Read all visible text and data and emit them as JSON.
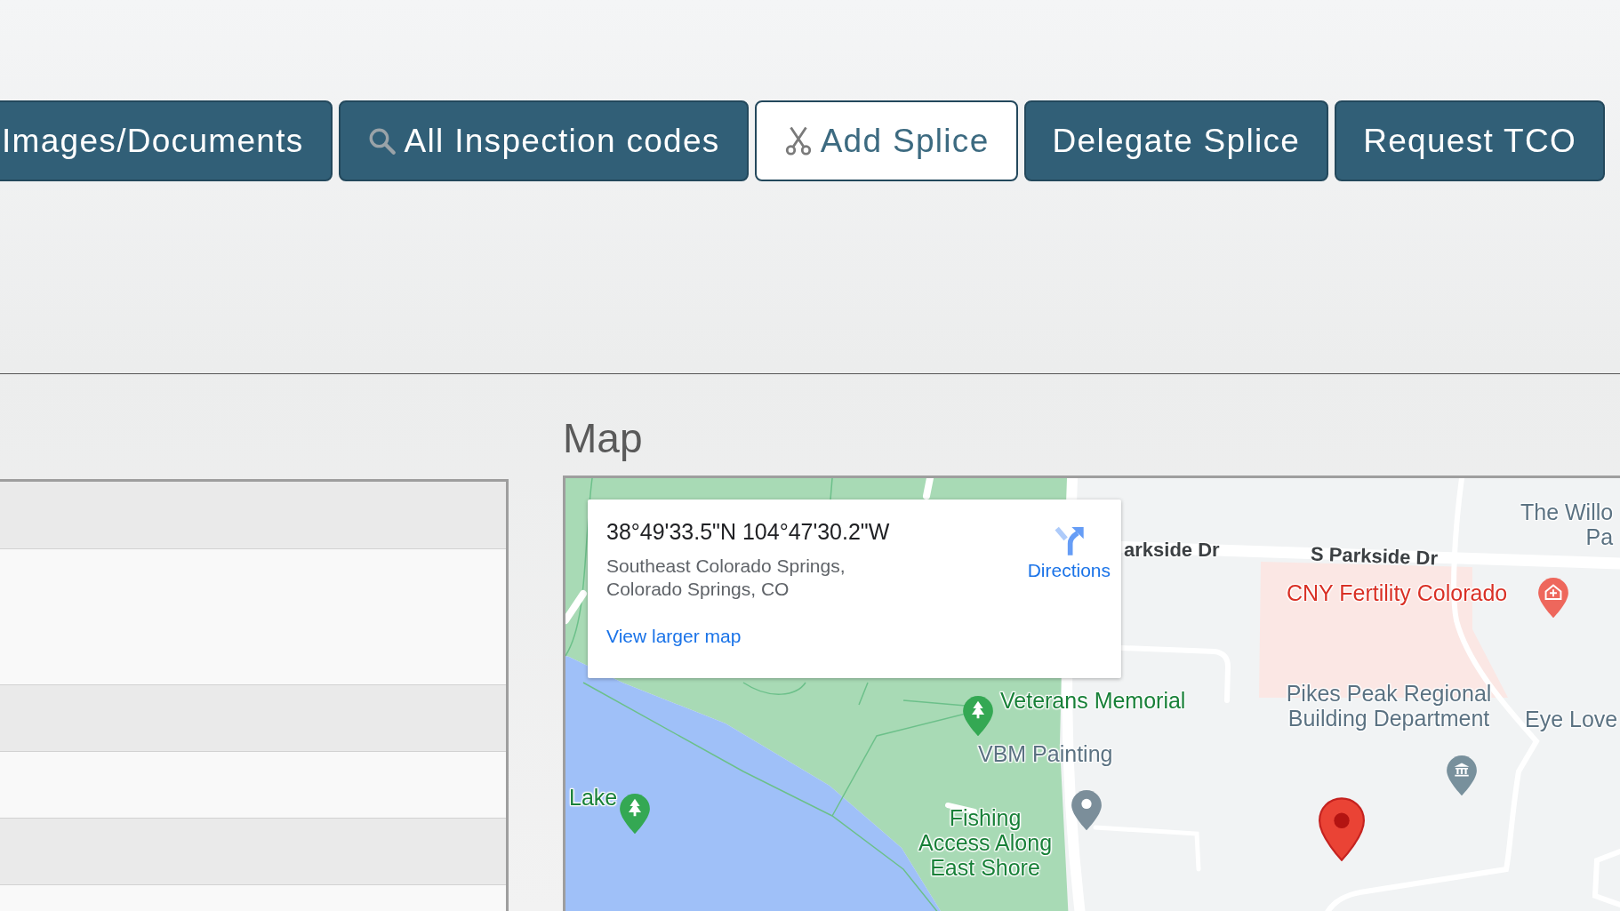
{
  "toolbar": {
    "buttons": [
      {
        "label": "Images/Documents",
        "kind": "plain",
        "hovered": false
      },
      {
        "label": "All Inspection codes",
        "kind": "search",
        "hovered": false
      },
      {
        "label": "Add Splice",
        "kind": "scissors",
        "hovered": true
      },
      {
        "label": "Delegate Splice",
        "kind": "plain",
        "hovered": false
      },
      {
        "label": "Request TCO",
        "kind": "plain",
        "hovered": false
      }
    ]
  },
  "map": {
    "heading": "Map",
    "popup": {
      "coordinates": "38°49'33.5\"N 104°47'30.2\"W",
      "address": "Southeast Colorado Springs, Colorado Springs, CO",
      "directions": "Directions",
      "link": "View larger map"
    },
    "labels": [
      {
        "text": "arkside Dr",
        "kind": "road"
      },
      {
        "text": "S Parkside Dr",
        "kind": "road"
      },
      {
        "text": "The Willo\nPa",
        "kind": "poi"
      },
      {
        "text": "CNY Fertility Colorado",
        "kind": "medical"
      },
      {
        "text": "Pikes Peak Regional\nBuilding Department",
        "kind": "poi"
      },
      {
        "text": "Eye Love",
        "kind": "poi"
      },
      {
        "text": "Veterans Memorial",
        "kind": "park"
      },
      {
        "text": "VBM Painting",
        "kind": "poi"
      },
      {
        "text": "Fishing\nAccess Along\nEast Shore",
        "kind": "park"
      },
      {
        "text": "Lake",
        "kind": "park"
      }
    ]
  }
}
